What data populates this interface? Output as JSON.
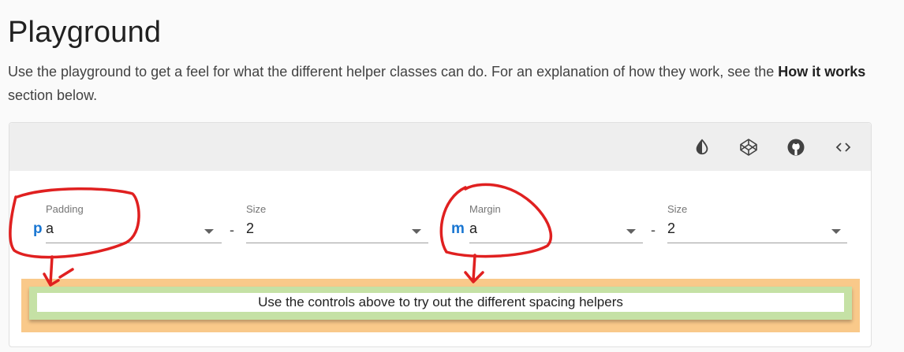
{
  "page": {
    "title": "Playground",
    "intro_before": "Use the playground to get a feel for what the different helper classes can do. For an explanation of how they work, see the ",
    "intro_bold": "How it works",
    "intro_after": " section below."
  },
  "toolbar": {
    "buttons": [
      {
        "icon": "invert-colors-icon"
      },
      {
        "icon": "codepen-icon"
      },
      {
        "icon": "github-icon"
      },
      {
        "icon": "code-icon"
      }
    ]
  },
  "controls": {
    "padding": {
      "label": "Padding",
      "prefix": "p",
      "value": "a"
    },
    "padding_size": {
      "label": "Size",
      "value": "2"
    },
    "separator": "-",
    "margin": {
      "label": "Margin",
      "prefix": "m",
      "value": "a"
    },
    "margin_size": {
      "label": "Size",
      "value": "2"
    }
  },
  "demo": {
    "text": "Use the controls above to try out the different spacing helpers",
    "colors": {
      "margin": "#f9c98a",
      "padding": "#c5e1a5",
      "content": "#ffffff"
    }
  },
  "annotation_color": "#e02020"
}
